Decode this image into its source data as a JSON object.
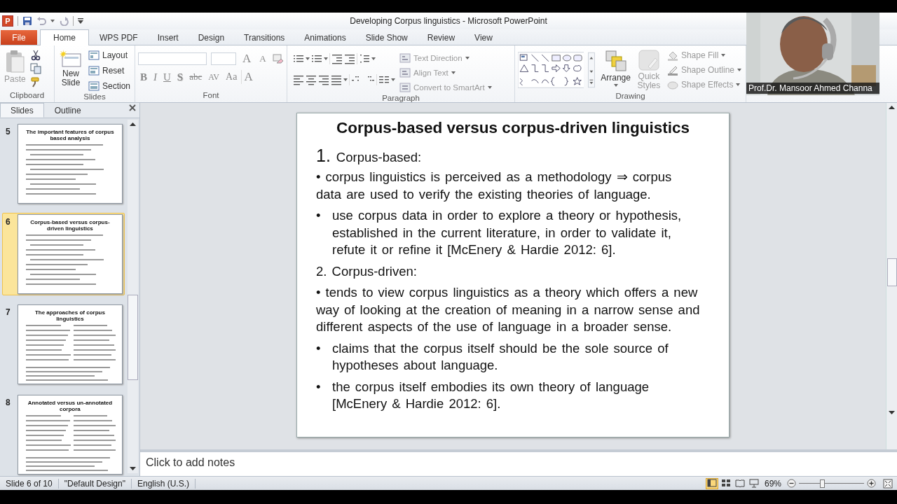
{
  "window": {
    "logo_text": "P",
    "title": "Developing Corpus linguistics - Microsoft PowerPoint"
  },
  "tabs": [
    {
      "label": "File",
      "kind": "file",
      "selected": false
    },
    {
      "label": "Home",
      "kind": "tab",
      "selected": true
    },
    {
      "label": "WPS PDF",
      "kind": "tab",
      "selected": false
    },
    {
      "label": "Insert",
      "kind": "tab",
      "selected": false
    },
    {
      "label": "Design",
      "kind": "tab",
      "selected": false
    },
    {
      "label": "Transitions",
      "kind": "tab",
      "selected": false
    },
    {
      "label": "Animations",
      "kind": "tab",
      "selected": false
    },
    {
      "label": "Slide Show",
      "kind": "tab",
      "selected": false
    },
    {
      "label": "Review",
      "kind": "tab",
      "selected": false
    },
    {
      "label": "View",
      "kind": "tab",
      "selected": false
    }
  ],
  "ribbon": {
    "clipboard": {
      "label": "Clipboard",
      "paste": {
        "label": "Paste",
        "disabled": true
      }
    },
    "slides": {
      "label": "Slides",
      "new_slide": "New Slide",
      "commands": [
        "Layout",
        "Reset",
        "Section"
      ]
    },
    "font": {
      "label": "Font",
      "size_buttons": [
        {
          "label": "A",
          "kind": "grow"
        },
        {
          "label": "A",
          "kind": "shrink"
        }
      ],
      "format_buttons": [
        {
          "label": "B",
          "kind": "bold"
        },
        {
          "label": "I",
          "kind": "italic"
        },
        {
          "label": "U",
          "kind": "underline"
        },
        {
          "label": "S",
          "kind": "shadow"
        },
        {
          "label": "abc",
          "kind": "strike"
        },
        {
          "label": "AV",
          "kind": "spacing"
        },
        {
          "label": "Aa",
          "kind": "case"
        },
        {
          "label": "A",
          "kind": "color"
        }
      ]
    },
    "paragraph": {
      "label": "Paragraph",
      "commands": [
        {
          "label": "Text Direction",
          "disabled": true
        },
        {
          "label": "Align Text",
          "disabled": true
        },
        {
          "label": "Convert to SmartArt",
          "disabled": true
        }
      ]
    },
    "drawing": {
      "label": "Drawing",
      "arrange": "Arrange",
      "quick_styles": {
        "label": "Quick Styles",
        "disabled": true
      },
      "commands": [
        {
          "label": "Shape Fill",
          "disabled": true
        },
        {
          "label": "Shape Outline",
          "disabled": true
        },
        {
          "label": "Shape Effects",
          "disabled": true
        }
      ]
    }
  },
  "webcam": {
    "caption": "Prof.Dr. Mansoor Ahmed Channa"
  },
  "panel_tabs": [
    {
      "label": "Slides",
      "selected": true
    },
    {
      "label": "Outline",
      "selected": false
    }
  ],
  "thumbnails": [
    {
      "number": "5",
      "title": "The important features of corpus based analysis",
      "kind": "list",
      "selected": false
    },
    {
      "number": "6",
      "title": "Corpus-based versus corpus-driven linguistics",
      "kind": "list",
      "selected": true
    },
    {
      "number": "7",
      "title": "The approaches of corpus linguistics",
      "kind": "two_column",
      "selected": false
    },
    {
      "number": "8",
      "title": "Annotated versus un-annotated corpora",
      "kind": "two_column",
      "selected": false
    }
  ],
  "slide": {
    "title": "Corpus-based versus corpus-driven linguistics",
    "blocks": [
      {
        "kind": "numbered_heading",
        "number": "1.",
        "text": "Corpus-based:"
      },
      {
        "kind": "paragraph",
        "text": "• corpus linguistics is perceived as a methodology ⇒ corpus data are used to verify the existing theories of language."
      },
      {
        "kind": "bullet",
        "marker": "•",
        "text": "use corpus data in order to explore a theory or hypothesis, established in the current literature, in order to validate it, refute it or refine it [McEnery & Hardie 2012: 6]."
      },
      {
        "kind": "heading",
        "text": "2. Corpus-driven:"
      },
      {
        "kind": "paragraph",
        "text": "• tends to view corpus linguistics as a theory which offers a new way of looking at the creation of meaning in a narrow sense and different aspects of the use of language in a broader sense."
      },
      {
        "kind": "bullet",
        "marker": "•",
        "text": "claims that the corpus itself should be the sole source of hypotheses about language."
      },
      {
        "kind": "bullet",
        "marker": "•",
        "text": "the corpus itself embodies its own theory of language [McEnery & Hardie 2012: 6]."
      }
    ]
  },
  "notes": {
    "placeholder": "Click to add notes"
  },
  "status_bar": {
    "items": [
      "Slide 6 of 10",
      "\"Default Design\"",
      "English (U.S.)"
    ],
    "views": [
      {
        "selected": true
      },
      {
        "selected": false
      },
      {
        "selected": false
      },
      {
        "selected": false
      }
    ],
    "zoom": "69%",
    "zoom_slider": {
      "level": 0.35
    }
  }
}
